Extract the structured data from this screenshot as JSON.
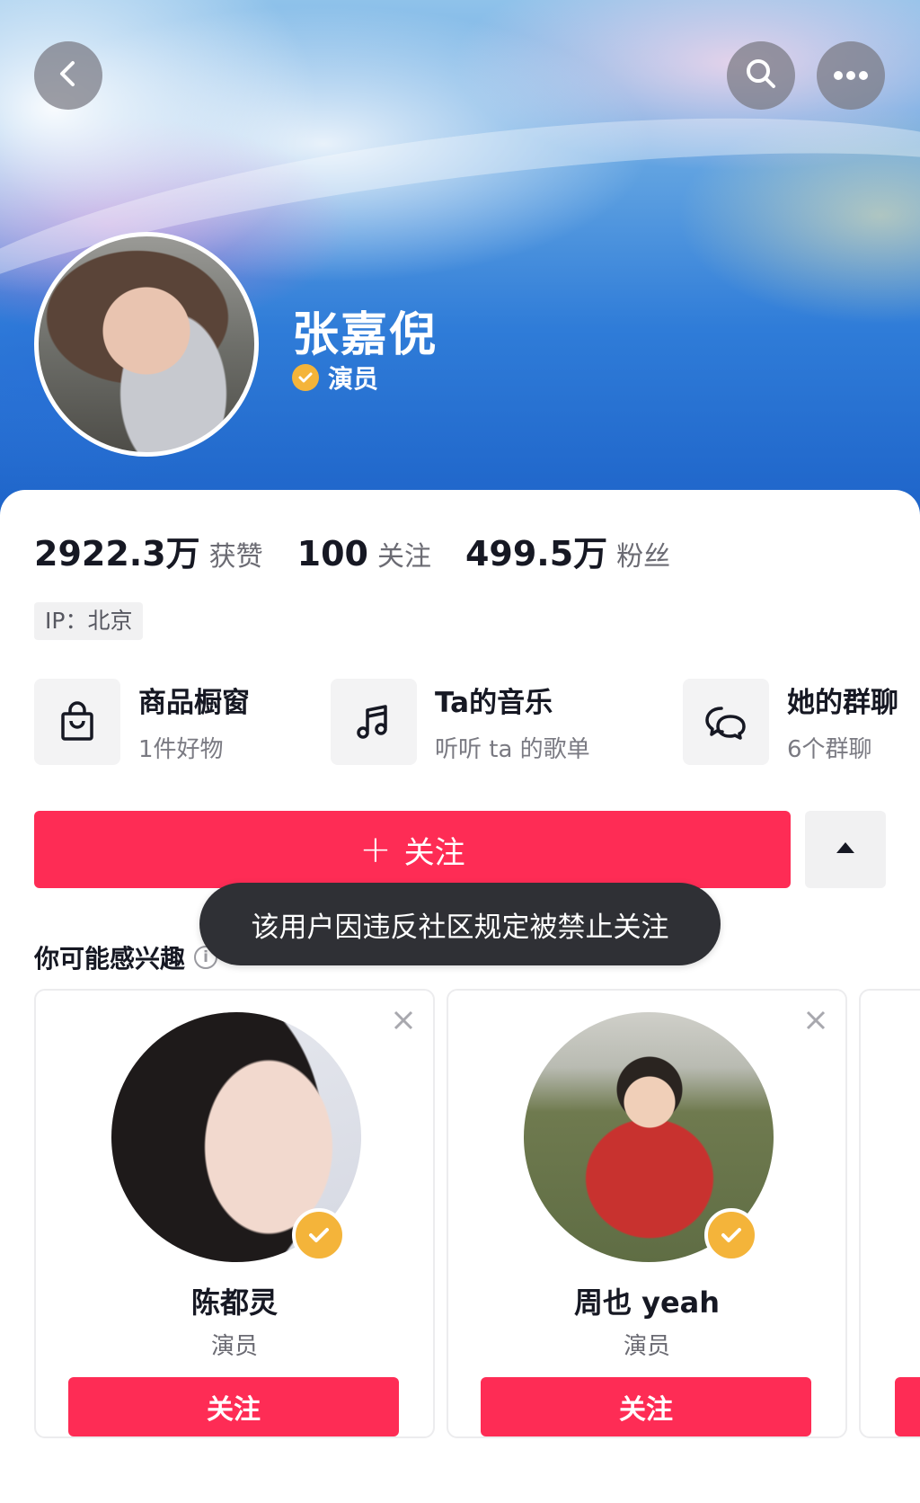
{
  "header": {
    "icons": {
      "back": "back-arrow-icon",
      "search": "search-icon",
      "more": "more-icon"
    }
  },
  "profile": {
    "name": "张嘉倪",
    "role": "演员",
    "verified_icon": "verified-badge-icon",
    "verified_color": "#f4b43a"
  },
  "stats": [
    {
      "value": "2922.3万",
      "label": "获赞"
    },
    {
      "value": "100",
      "label": "关注"
    },
    {
      "value": "499.5万",
      "label": "粉丝"
    }
  ],
  "ip": "IP：北京",
  "features": [
    {
      "title": "商品橱窗",
      "subtitle": "1件好物",
      "icon": "shopping-bag-icon"
    },
    {
      "title": "Ta的音乐",
      "subtitle": "听听 ta 的歌单",
      "icon": "music-note-icon"
    },
    {
      "title": "她的群聊",
      "subtitle": "6个群聊",
      "icon": "chat-bubbles-icon"
    }
  ],
  "follow_button": {
    "plus": "+",
    "label": "关注",
    "color": "#fe2c55"
  },
  "toast": "该用户因违反社区规定被禁止关注",
  "suggestions": {
    "title": "你可能感兴趣",
    "info_icon": "info-icon",
    "items": [
      {
        "name": "陈都灵",
        "role": "演员",
        "button": "关注"
      },
      {
        "name": "周也 yeah",
        "role": "演员",
        "button": "关注"
      }
    ]
  }
}
